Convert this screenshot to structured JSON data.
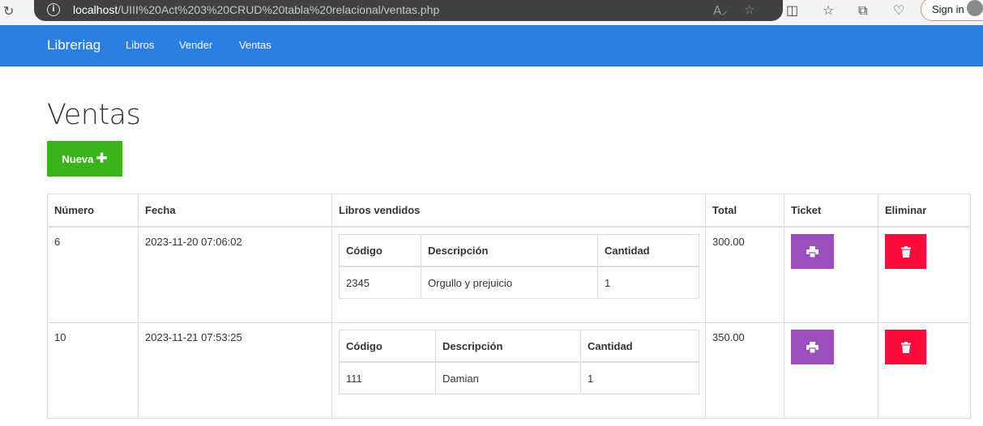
{
  "browser": {
    "url_host": "localhost",
    "url_path": "/UIII%20Act%203%20CRUD%20tabla%20relacional/ventas.php",
    "signin_label": "Sign in"
  },
  "navbar": {
    "brand": "Libreriag",
    "links": [
      "Libros",
      "Vender",
      "Ventas"
    ],
    "color": "#2b7fe3"
  },
  "page": {
    "title": "Ventas",
    "new_button": "Nueva",
    "new_button_icon": "plus-icon"
  },
  "table": {
    "headers": [
      "Número",
      "Fecha",
      "Libros vendidos",
      "Total",
      "Ticket",
      "Eliminar"
    ],
    "inner_headers": [
      "Código",
      "Descripción",
      "Cantidad"
    ],
    "rows": [
      {
        "numero": "6",
        "fecha": "2023-11-20 07:06:02",
        "libros": [
          {
            "codigo": "2345",
            "descripcion": "Orgullo y prejuicio",
            "cantidad": "1"
          }
        ],
        "total": "300.00"
      },
      {
        "numero": "10",
        "fecha": "2023-11-21 07:53:25",
        "libros": [
          {
            "codigo": "111",
            "descripcion": "Damian",
            "cantidad": "1"
          }
        ],
        "total": "350.00"
      }
    ]
  },
  "colors": {
    "nueva": "#3bb41b",
    "ticket": "#9b4fbd",
    "eliminar": "#ff0a3a"
  }
}
